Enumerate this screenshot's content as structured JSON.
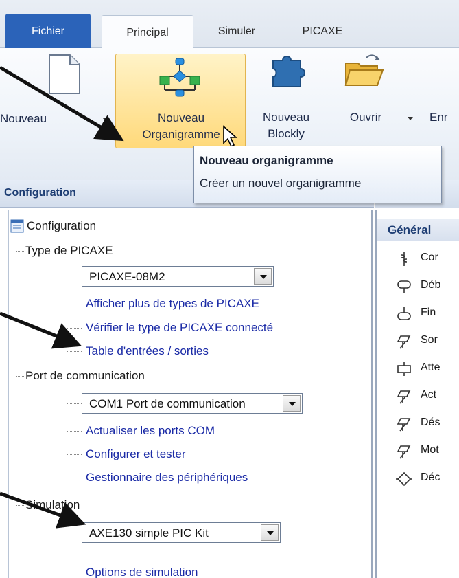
{
  "tabs": {
    "fichier": "Fichier",
    "principal": "Principal",
    "simuler": "Simuler",
    "picaxe": "PICAXE"
  },
  "ribbon": {
    "nouveau": "Nouveau",
    "nouveau_orga_line1": "Nouveau",
    "nouveau_orga_line2": "Organigramme",
    "nouveau_blockly_line1": "Nouveau",
    "nouveau_blockly_line2": "Blockly",
    "ouvrir": "Ouvrir",
    "enregistrer_partial": "Enr"
  },
  "tooltip": {
    "title": "Nouveau organigramme",
    "description": "Créer un nouvel organigramme"
  },
  "config_panel": {
    "header": "Configuration",
    "root": "Configuration",
    "type_picaxe": "Type de PICAXE",
    "picaxe_select": "PICAXE-08M2",
    "link_more_types": "Afficher plus de types de PICAXE",
    "link_check_type": "Vérifier le type de PICAXE connecté",
    "link_io_table": "Table d'entrées / sorties",
    "port_comm": "Port de communication",
    "port_select": "COM1 Port de communication",
    "link_refresh_com": "Actualiser les ports COM",
    "link_configure": "Configurer et tester",
    "link_device_manager": "Gestionnaire des périphériques",
    "simulation": "Simulation",
    "sim_select": "AXE130 simple PIC Kit",
    "link_sim_options": "Options de simulation"
  },
  "right_panel": {
    "general": "Général",
    "commands": [
      "Cor",
      "Déb",
      "Fin",
      "Sor",
      "Atte",
      "Act",
      "Dés",
      "Mot",
      "Déc"
    ]
  },
  "colors": {
    "tab_fichier": "#2b63b9",
    "link_blue": "#1a2aa6",
    "highlight_button": "#ffd97a",
    "header_text": "#1d3d73"
  }
}
